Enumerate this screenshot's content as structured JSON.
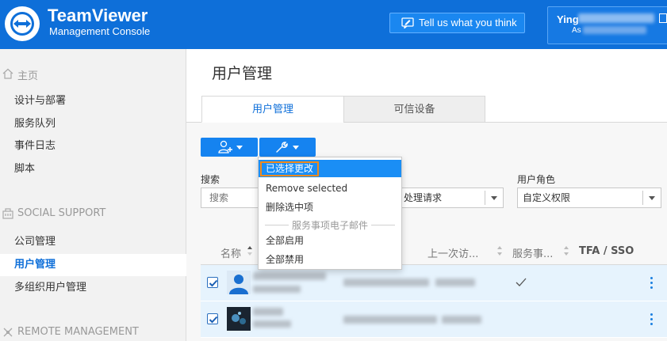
{
  "header": {
    "brand": "TeamViewer",
    "subtitle": "Management Console",
    "feedback_label": "Tell us what you think",
    "user_name": "Ying",
    "user_sub": "As"
  },
  "sidebar": {
    "sections": [
      {
        "label": "主页",
        "icon": "home-icon"
      },
      {
        "label": "SOCIAL SUPPORT",
        "icon": "building-icon"
      },
      {
        "label": "REMOTE MANAGEMENT",
        "icon": "cross-icon"
      }
    ],
    "home_items": [
      "设计与部署",
      "服务队列",
      "事件日志",
      "脚本"
    ],
    "social_items": [
      "公司管理",
      "用户管理",
      "多组织用户管理"
    ],
    "active_item": "用户管理"
  },
  "main": {
    "page_title": "用户管理",
    "tabs": [
      {
        "label": "用户管理",
        "active": true
      },
      {
        "label": "可信设备",
        "active": false
      }
    ],
    "filters": {
      "search_label": "搜索",
      "search_placeholder": "搜索",
      "select2_value": "处理请求",
      "role_label": "用户角色",
      "role_value": "自定义权限"
    },
    "table": {
      "columns": [
        "名称",
        "上一次访...",
        "服务事...",
        "TFA / SSO"
      ]
    }
  },
  "menu": {
    "items": [
      "已选择更改",
      "Remove selected",
      "删除选中项"
    ],
    "section_header": "服务事项电子邮件",
    "section_items": [
      "全部启用",
      "全部禁用"
    ]
  },
  "colors": {
    "brand_blue": "#0e6fd9",
    "button_blue": "#1583f0",
    "highlight_orange": "#f08a1c"
  }
}
